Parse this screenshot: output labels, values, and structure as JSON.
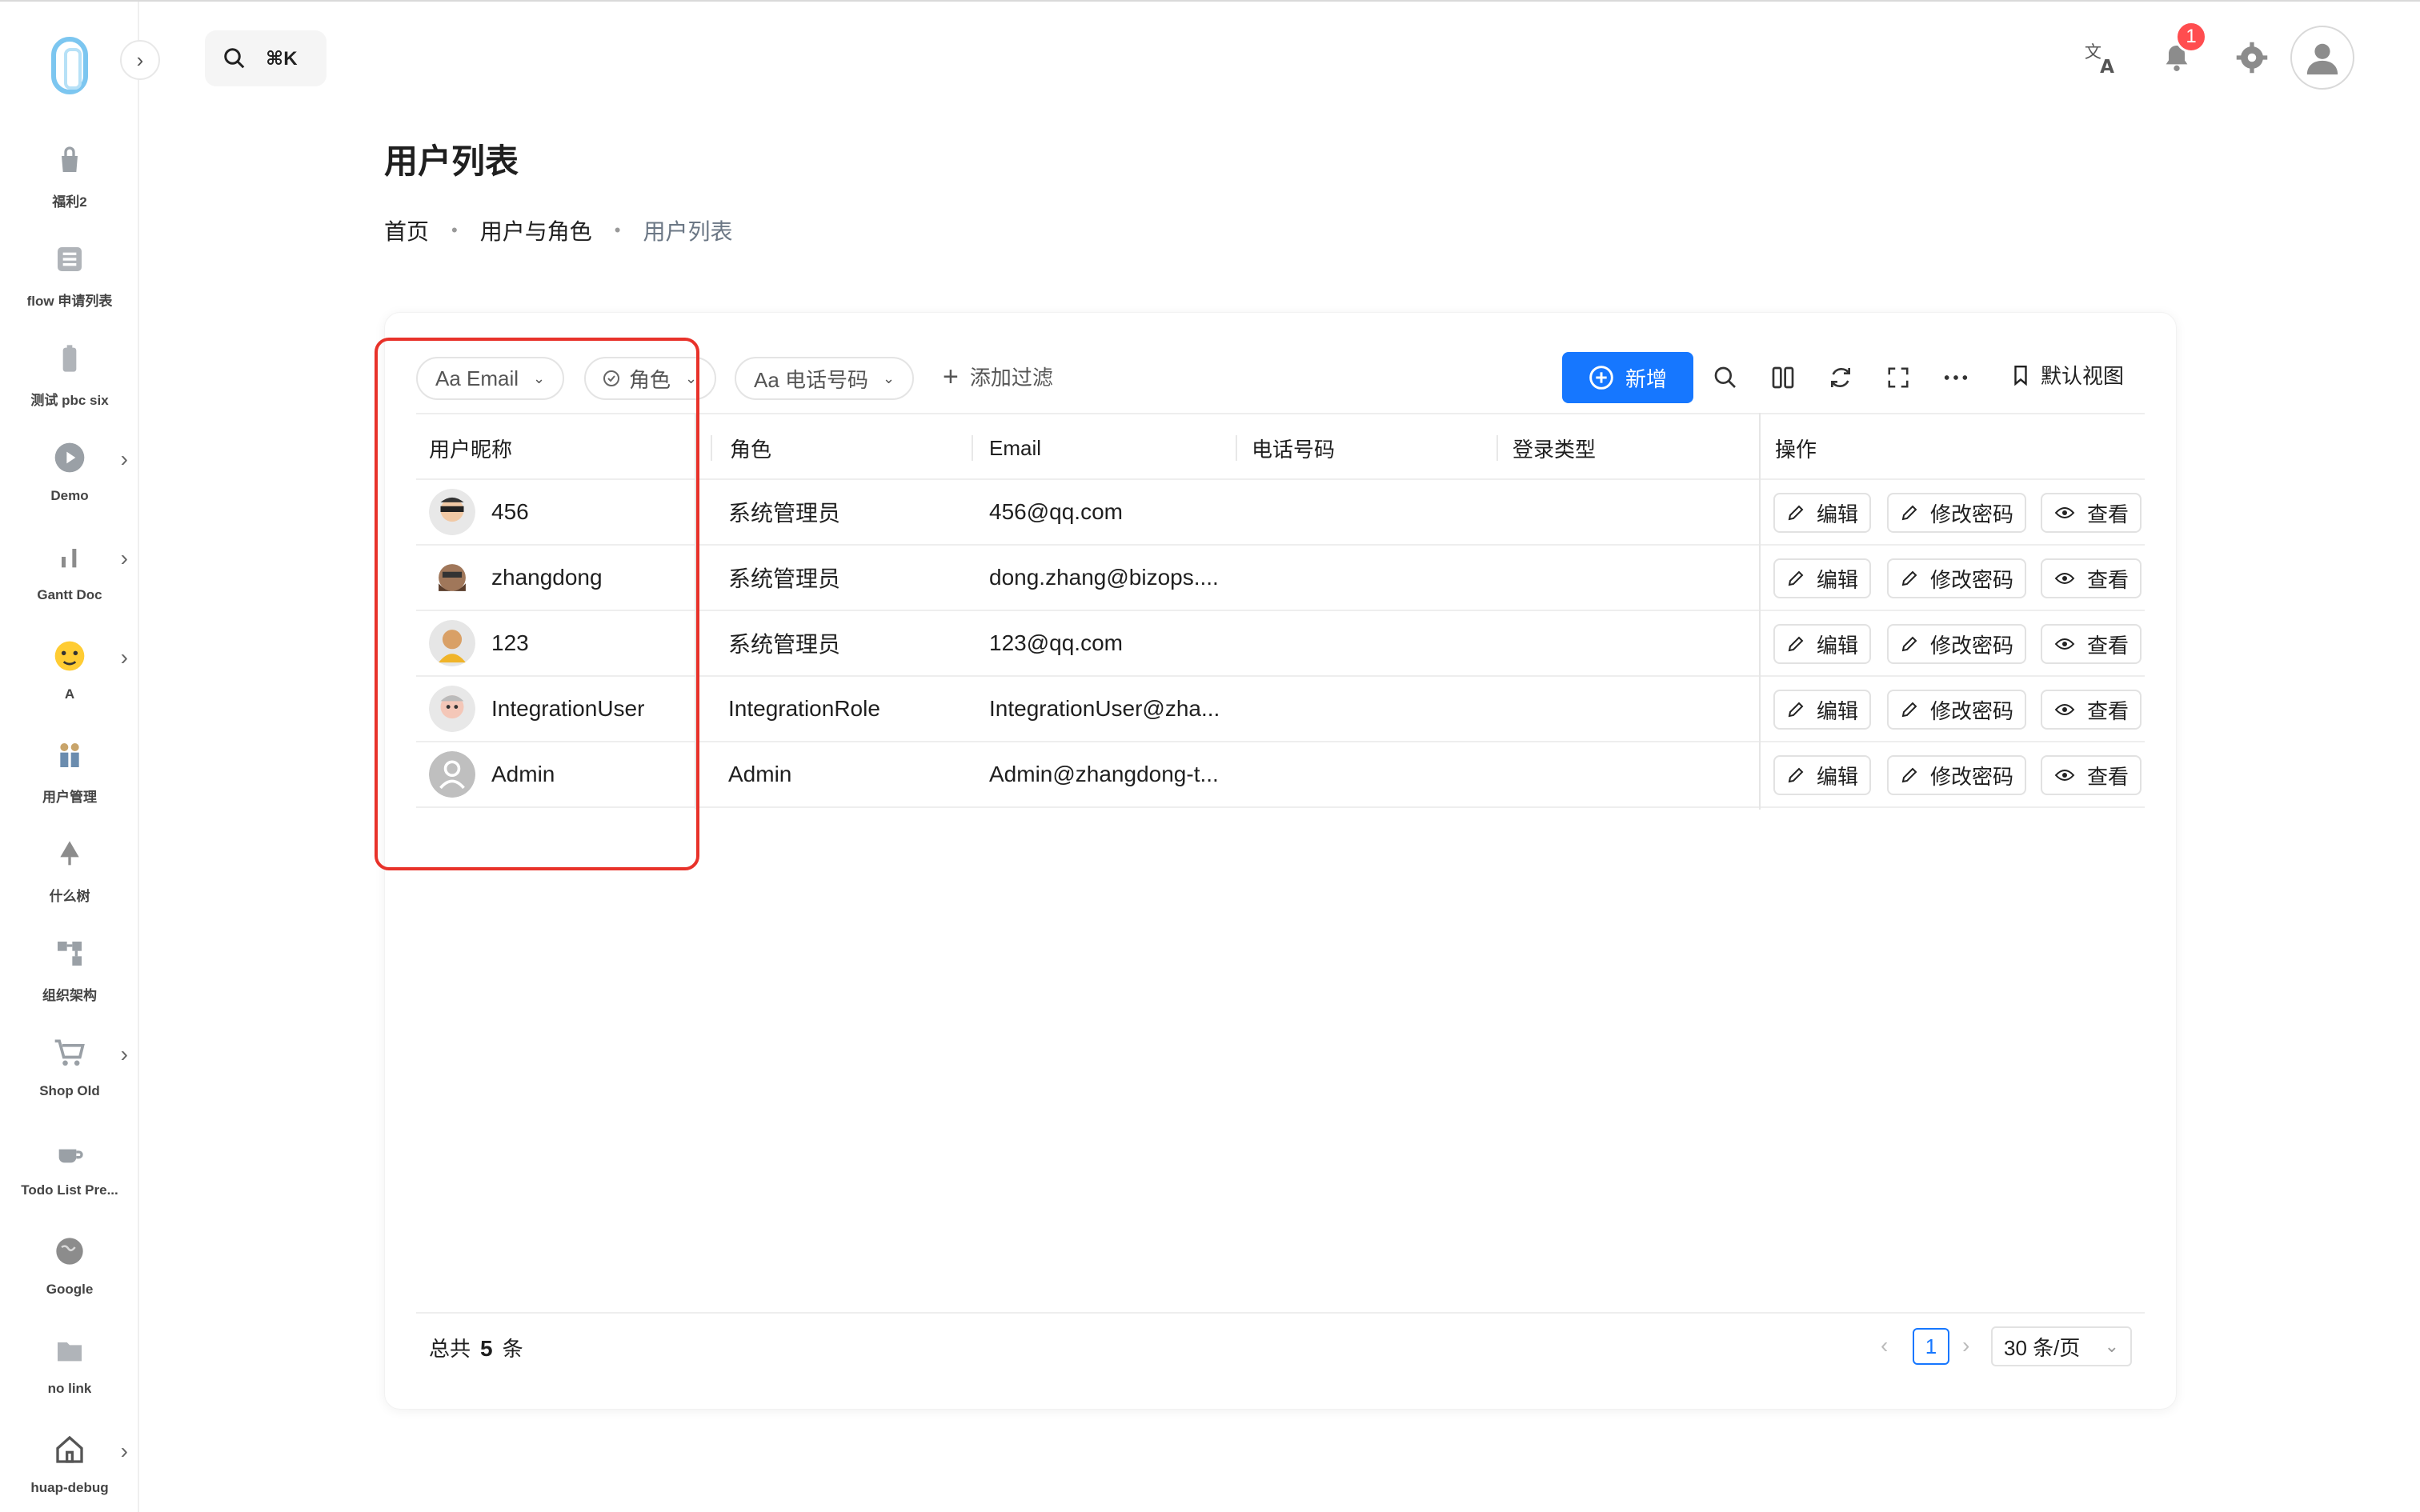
{
  "sidebar": {
    "items": [
      {
        "label": "福利2",
        "icon": "bag-icon",
        "has_arrow": false
      },
      {
        "label": "flow 申请列表",
        "icon": "list-icon",
        "has_arrow": false
      },
      {
        "label": "测试 pbc six",
        "icon": "battery-icon",
        "has_arrow": false
      },
      {
        "label": "Demo",
        "icon": "play-icon",
        "has_arrow": true
      },
      {
        "label": "Gantt Doc",
        "icon": "bar-chart-icon",
        "has_arrow": true
      },
      {
        "label": "A",
        "icon": "emoji-icon",
        "has_arrow": true
      },
      {
        "label": "用户管理",
        "icon": "people-icon",
        "has_arrow": false
      },
      {
        "label": "什么树",
        "icon": "tree-icon",
        "has_arrow": false
      },
      {
        "label": "组织架构",
        "icon": "org-icon",
        "has_arrow": false
      },
      {
        "label": "Shop Old",
        "icon": "cart-icon",
        "has_arrow": true
      },
      {
        "label": "Todo List Pre...",
        "icon": "coffee-icon",
        "has_arrow": false
      },
      {
        "label": "Google",
        "icon": "globe-icon",
        "has_arrow": false
      },
      {
        "label": "no link",
        "icon": "folder-icon",
        "has_arrow": false
      },
      {
        "label": "huap-debug",
        "icon": "home-icon",
        "has_arrow": true
      }
    ]
  },
  "search": {
    "shortcut": "⌘K"
  },
  "header": {
    "notification_count": "1"
  },
  "page": {
    "title": "用户列表",
    "breadcrumb": [
      "首页",
      "用户与角色",
      "用户列表"
    ]
  },
  "filters": {
    "chips": [
      "Aa Email",
      "角色",
      "Aa 电话号码"
    ],
    "add_filter": "添加过滤"
  },
  "toolbar": {
    "new_label": "新增",
    "default_view": "默认视图"
  },
  "table": {
    "columns": [
      "用户昵称",
      "角色",
      "Email",
      "电话号码",
      "登录类型",
      "操作"
    ],
    "rows": [
      {
        "name": "456",
        "role": "系统管理员",
        "email": "456@qq.com",
        "phone": "",
        "login_type": ""
      },
      {
        "name": "zhangdong",
        "role": "系统管理员",
        "email": "dong.zhang@bizops....",
        "phone": "",
        "login_type": ""
      },
      {
        "name": "123",
        "role": "系统管理员",
        "email": "123@qq.com",
        "phone": "",
        "login_type": ""
      },
      {
        "name": "IntegrationUser",
        "role": "IntegrationRole",
        "email": "IntegrationUser@zha...",
        "phone": "",
        "login_type": ""
      },
      {
        "name": "Admin",
        "role": "Admin",
        "email": "Admin@zhangdong-t...",
        "phone": "",
        "login_type": ""
      }
    ],
    "actions": {
      "edit": "编辑",
      "change_password": "修改密码",
      "view": "查看"
    }
  },
  "footer": {
    "total_prefix": "总共",
    "total_count": "5",
    "total_suffix": "条",
    "current_page": "1",
    "page_size": "30 条/页"
  },
  "colors": {
    "primary": "#1677ff",
    "highlight": "#e8322a",
    "badge": "#ff4d4f"
  }
}
